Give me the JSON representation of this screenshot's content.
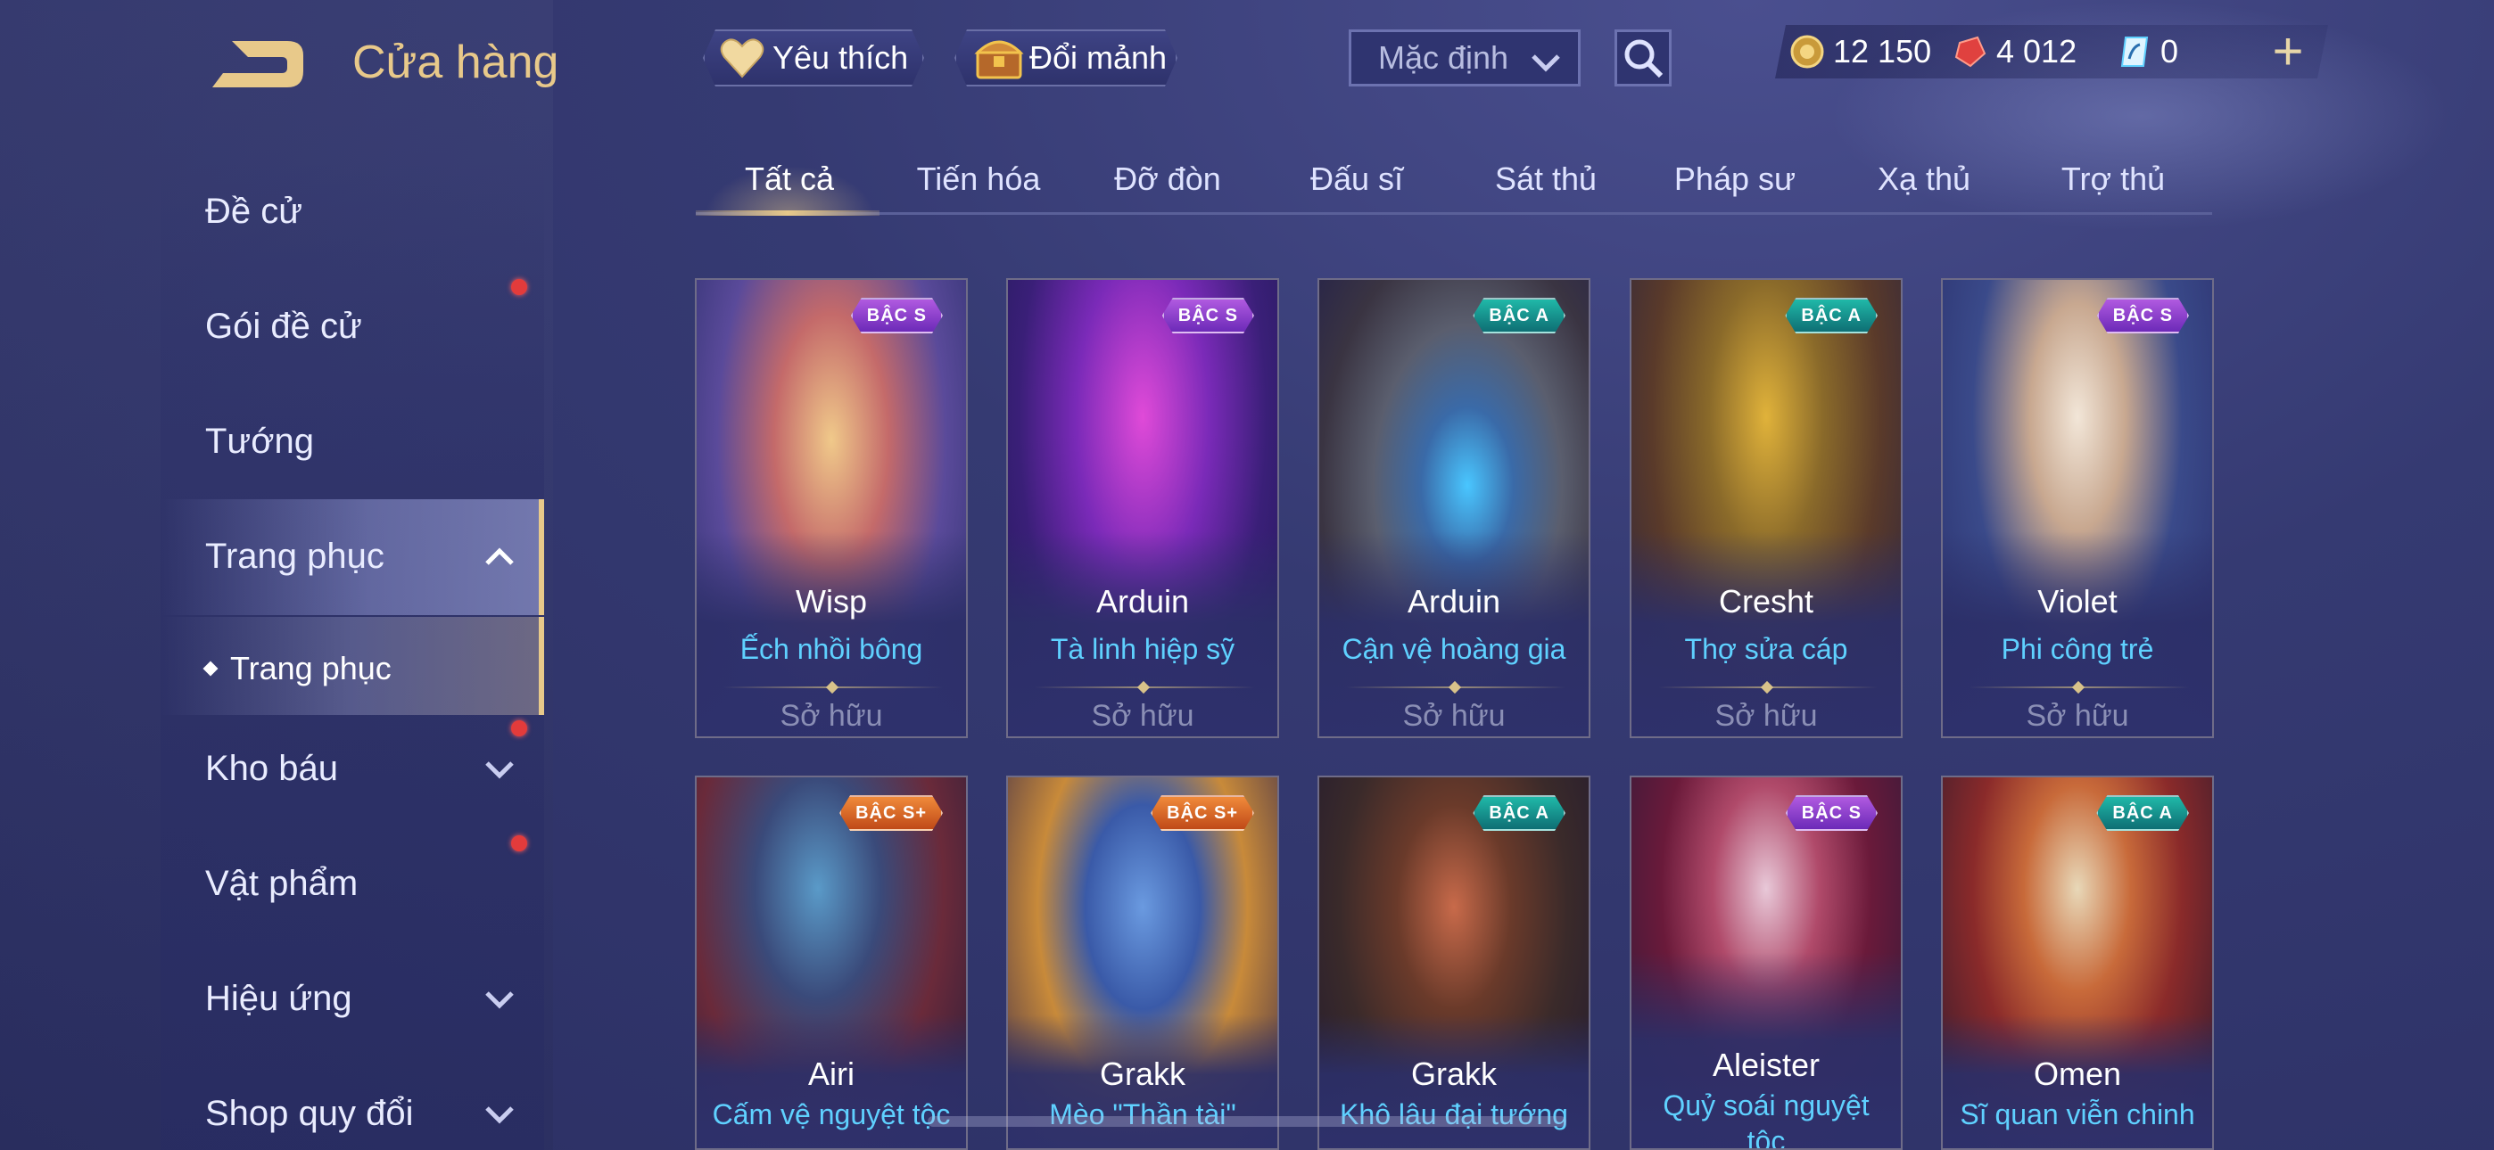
{
  "header": {
    "title": "Cửa hàng",
    "favorites_label": "Yêu thích",
    "exchange_label": "Đổi mảnh",
    "sort_value": "Mặc định",
    "currencies": {
      "gold": "12 150",
      "ruby": "4 012",
      "ticket": "0"
    },
    "add_label": "+"
  },
  "sidebar": {
    "items": [
      {
        "label": "Đề cử"
      },
      {
        "label": "Gói đề cử"
      },
      {
        "label": "Tướng"
      },
      {
        "label": "Trang phục"
      },
      {
        "label": "Kho báu"
      },
      {
        "label": "Vật phẩm"
      },
      {
        "label": "Hiệu ứng"
      },
      {
        "label": "Shop quy đổi"
      }
    ],
    "sub_item": "Trang phục"
  },
  "tabs": [
    "Tất cả",
    "Tiến hóa",
    "Đỡ đòn",
    "Đấu sĩ",
    "Sát thủ",
    "Pháp sư",
    "Xạ thủ",
    "Trợ thủ"
  ],
  "cards": [
    {
      "hero": "Wisp",
      "skin": "Ếch nhồi bông",
      "badge": "BẬC S",
      "status": "Sở hữu"
    },
    {
      "hero": "Arduin",
      "skin": "Tà linh hiệp sỹ",
      "badge": "BẬC S",
      "status": "Sở hữu"
    },
    {
      "hero": "Arduin",
      "skin": "Cận vệ hoàng gia",
      "badge": "BẬC A",
      "status": "Sở hữu"
    },
    {
      "hero": "Cresht",
      "skin": "Thợ sửa cáp",
      "badge": "BẬC A",
      "status": "Sở hữu"
    },
    {
      "hero": "Violet",
      "skin": "Phi công trẻ",
      "badge": "BẬC S",
      "status": "Sở hữu"
    },
    {
      "hero": "Airi",
      "skin": "Cấm vệ nguyệt tộc",
      "badge": "BẬC S+"
    },
    {
      "hero": "Grakk",
      "skin": "Mèo \"Thần tài\"",
      "badge": "BẬC S+"
    },
    {
      "hero": "Grakk",
      "skin": "Khô lâu đại tướng",
      "badge": "BẬC A"
    },
    {
      "hero": "Aleister",
      "skin": "Quỷ soái nguyệt tộc",
      "badge": "BẬC S"
    },
    {
      "hero": "Omen",
      "skin": "Sĩ quan viễn chinh",
      "badge": "BẬC A"
    }
  ],
  "colors": {
    "accent_gold": "#e8c98a",
    "skin_name": "#5fd1ff",
    "notification": "#e33b3b",
    "badge_s": "#8a3fcf",
    "badge_a": "#17918c",
    "badge_s_plus": "#e06a28"
  },
  "icons": {
    "back": "back-arrow-icon",
    "favorites": "heart-icon",
    "exchange": "treasure-chest-icon",
    "sort": "chevron-down-icon",
    "search": "search-icon",
    "gold": "gold-coin-icon",
    "ruby": "ruby-gem-icon",
    "ticket": "voucher-icon",
    "add": "plus-icon"
  }
}
